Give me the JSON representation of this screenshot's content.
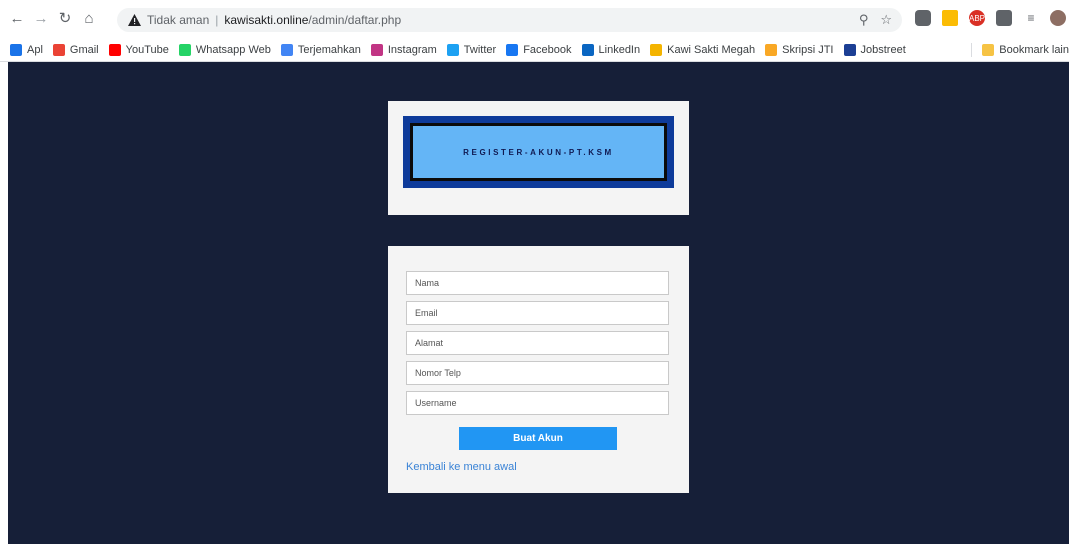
{
  "browser": {
    "security_text": "Tidak aman",
    "url_host": "kawisakti.online",
    "url_path": "/admin/daftar.php",
    "icons": [
      "back-icon",
      "forward-icon",
      "reload-icon",
      "home-icon",
      "warning-icon",
      "zoom-icon",
      "star-icon"
    ]
  },
  "bookmarks": {
    "items": [
      {
        "label": "Apl",
        "icon": "apps-icon",
        "color": "#1a73e8"
      },
      {
        "label": "Gmail",
        "icon": "gmail-icon",
        "color": "#ea4335"
      },
      {
        "label": "YouTube",
        "icon": "youtube-icon",
        "color": "#ff0000"
      },
      {
        "label": "Whatsapp Web",
        "icon": "whatsapp-icon",
        "color": "#25d366"
      },
      {
        "label": "Terjemahkan",
        "icon": "translate-icon",
        "color": "#4285f4"
      },
      {
        "label": "Instagram",
        "icon": "instagram-icon",
        "color": "#c13584"
      },
      {
        "label": "Twitter",
        "icon": "twitter-icon",
        "color": "#1da1f2"
      },
      {
        "label": "Facebook",
        "icon": "facebook-icon",
        "color": "#1877f2"
      },
      {
        "label": "LinkedIn",
        "icon": "linkedin-icon",
        "color": "#0a66c2"
      },
      {
        "label": "Kawi Sakti Megah",
        "icon": "ksm-icon",
        "color": "#f4b400"
      },
      {
        "label": "Skripsi JTI",
        "icon": "skripsi-icon",
        "color": "#f9a825"
      },
      {
        "label": "Jobstreet",
        "icon": "jobstreet-icon",
        "color": "#1c3f94"
      }
    ],
    "other_label": "Bookmark lain"
  },
  "header_card": {
    "title": "REGISTER-AKUN-PT.KSM"
  },
  "form": {
    "fields": [
      {
        "placeholder": "Nama"
      },
      {
        "placeholder": "Email"
      },
      {
        "placeholder": "Alamat"
      },
      {
        "placeholder": "Nomor Telp"
      },
      {
        "placeholder": "Username"
      }
    ],
    "submit_label": "Buat Akun",
    "back_link": "Kembali ke menu awal"
  },
  "colors": {
    "page_bg": "#161f38",
    "card_bg": "#f4f4f4",
    "banner_outer": "#0e3b9a",
    "banner_inner": "#64b5f6",
    "button": "#2196f3",
    "link": "#3a83d6"
  }
}
